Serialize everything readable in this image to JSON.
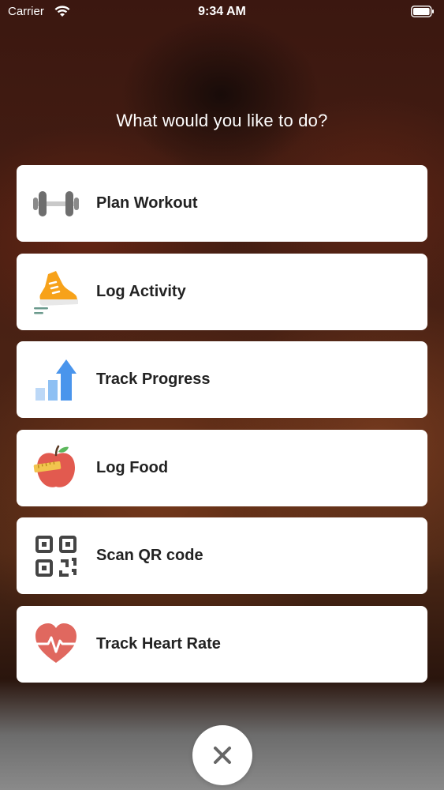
{
  "status_bar": {
    "carrier": "Carrier",
    "time": "9:34 AM"
  },
  "prompt": "What would you like to do?",
  "menu": {
    "items": [
      {
        "label": "Plan Workout",
        "icon": "dumbbell-icon"
      },
      {
        "label": "Log Activity",
        "icon": "running-shoe-icon"
      },
      {
        "label": "Track Progress",
        "icon": "progress-chart-icon"
      },
      {
        "label": "Log Food",
        "icon": "apple-icon"
      },
      {
        "label": "Scan QR code",
        "icon": "qr-code-icon"
      },
      {
        "label": "Track Heart Rate",
        "icon": "heart-rate-icon"
      }
    ]
  },
  "close": {
    "icon": "close-icon"
  },
  "colors": {
    "card": "#ffffff",
    "text": "#222222",
    "close_icon": "#666666"
  }
}
